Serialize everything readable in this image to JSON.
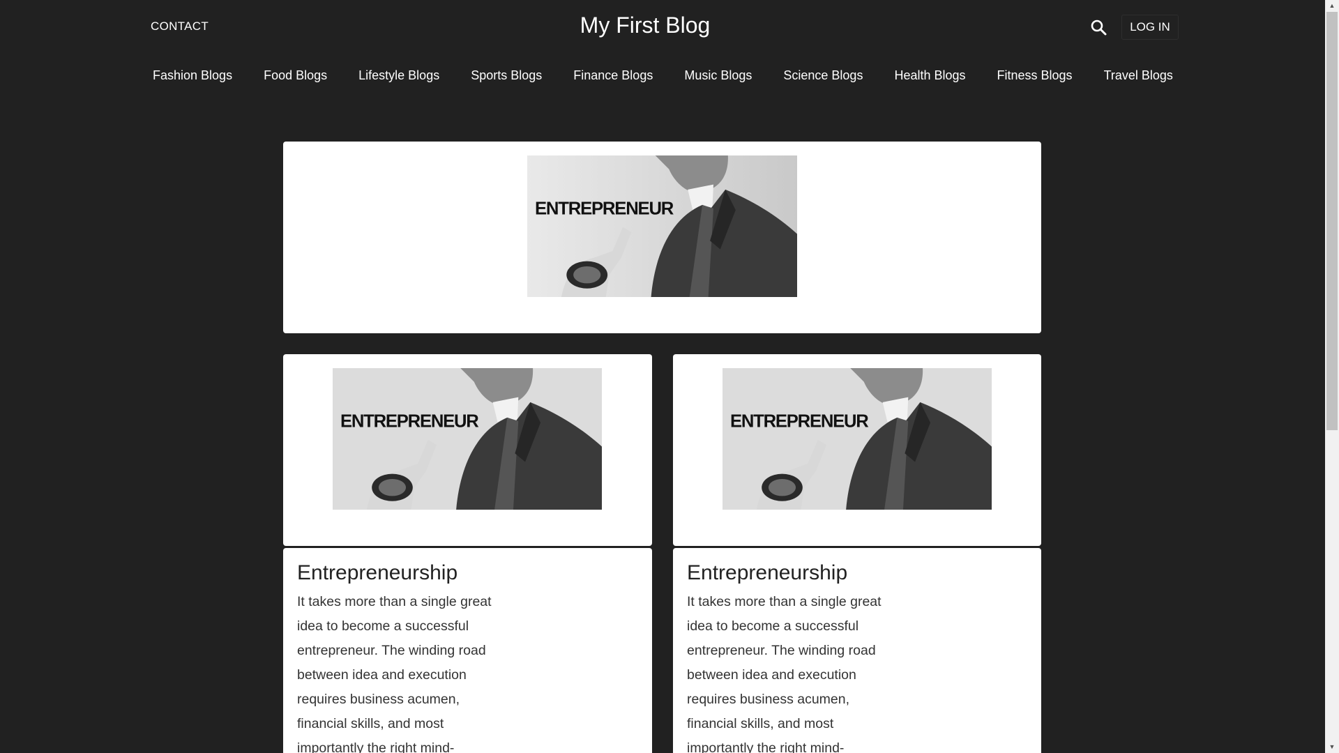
{
  "header": {
    "contact_label": "CONTACT",
    "site_title": "My First Blog",
    "login_label": "LOG IN",
    "search_icon": "search-icon"
  },
  "nav": {
    "items": [
      {
        "label": "Fashion Blogs"
      },
      {
        "label": "Food Blogs"
      },
      {
        "label": "Lifestyle Blogs"
      },
      {
        "label": "Sports Blogs"
      },
      {
        "label": "Finance Blogs"
      },
      {
        "label": "Music Blogs"
      },
      {
        "label": "Science Blogs"
      },
      {
        "label": "Health Blogs"
      },
      {
        "label": "Fitness Blogs"
      },
      {
        "label": "Travel Blogs"
      }
    ]
  },
  "hero": {
    "image_text": "ENTREPRENEUR"
  },
  "posts": [
    {
      "image_text": "ENTREPRENEUR",
      "title": "Entrepreneurship",
      "excerpt": "It takes more than a single great idea to become a successful entrepreneur. The winding road between idea and execution requires business acumen, financial skills, and most importantly the right mind-"
    },
    {
      "image_text": "ENTREPRENEUR",
      "title": "Entrepreneurship",
      "excerpt": "It takes more than a single great idea to become a successful entrepreneur. The winding road between idea and execution requires business acumen, financial skills, and most importantly the right mind-"
    }
  ],
  "colors": {
    "background": "#212121",
    "card": "#ffffff",
    "text_dark": "#222222"
  }
}
